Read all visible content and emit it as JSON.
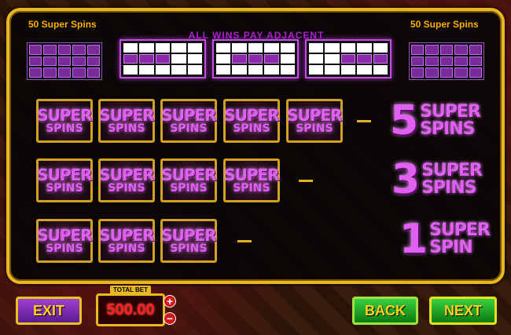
{
  "corner": {
    "left_title": "50 Super Spins",
    "right_title": "50 Super Spins"
  },
  "paytable": {
    "title": "ALL WINS PAY ADJACENT"
  },
  "symbol": {
    "line1": "SUPER",
    "line2": "SPINS"
  },
  "rows": [
    {
      "count": 5,
      "award_num": "5",
      "award_top": "SUPER",
      "award_bottom": "SPINS"
    },
    {
      "count": 4,
      "award_num": "3",
      "award_top": "SUPER",
      "award_bottom": "SPINS"
    },
    {
      "count": 3,
      "award_num": "1",
      "award_top": "SUPER",
      "award_bottom": "SPIN"
    }
  ],
  "controls": {
    "exit_label": "EXIT",
    "back_label": "BACK",
    "next_label": "NEXT",
    "bet_label": "TOTAL BET",
    "bet_value": "500.00",
    "bet_plus": "+",
    "bet_minus": "−"
  },
  "colors": {
    "gold": "#e8b820",
    "purple": "#e060f0",
    "bet_red": "#ff2020"
  }
}
